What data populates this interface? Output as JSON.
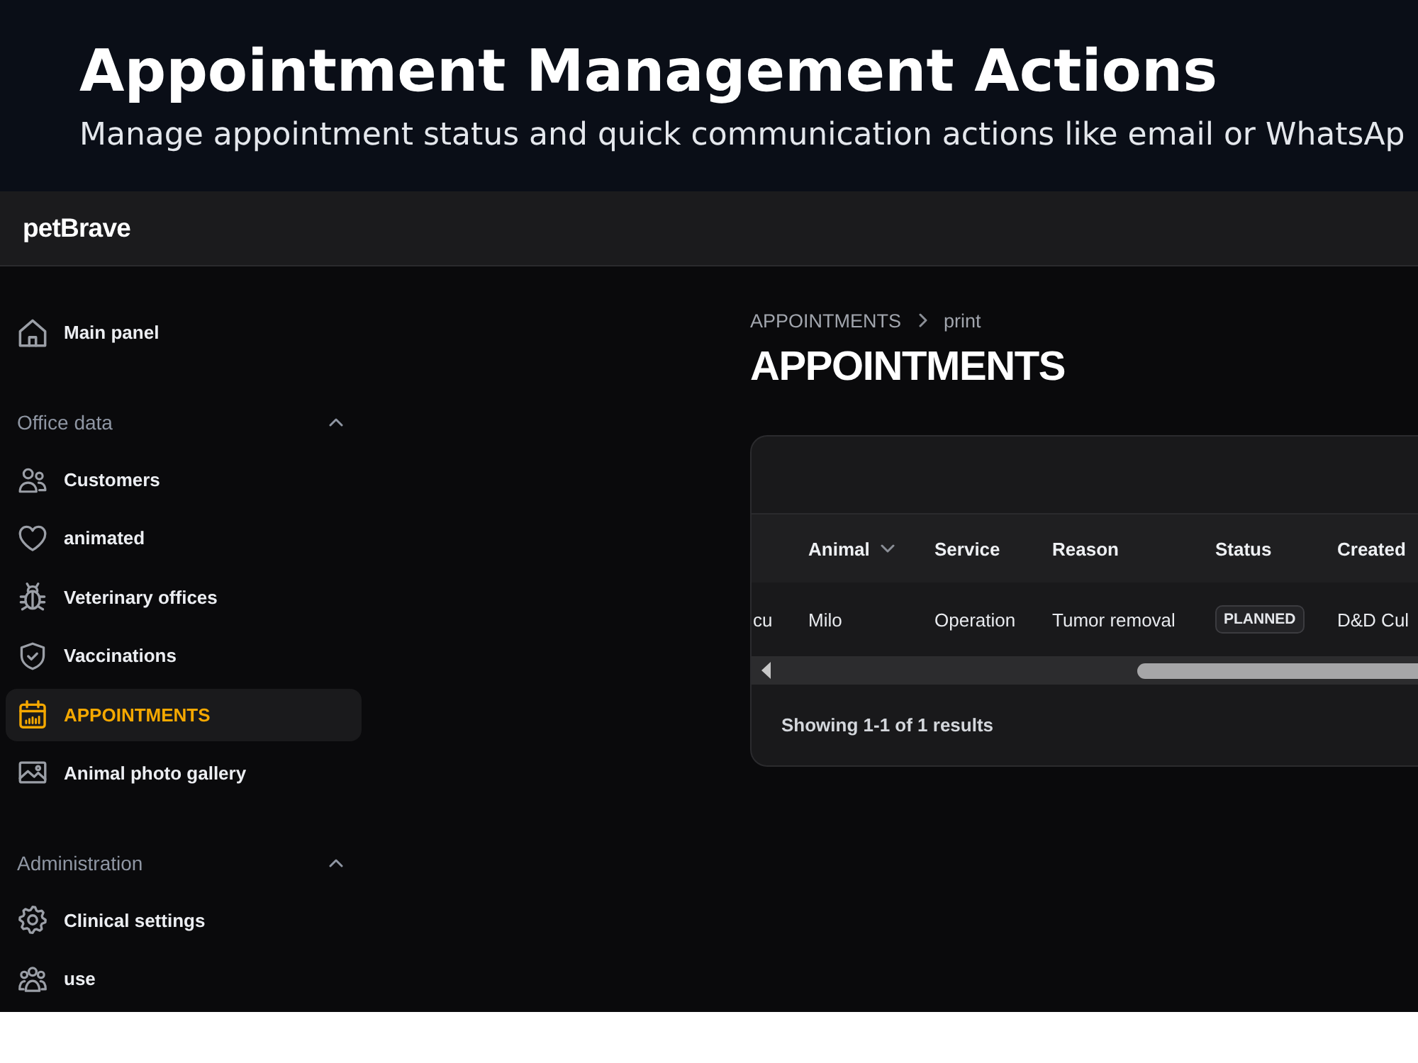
{
  "banner": {
    "title": "Appointment Management Actions",
    "subtitle": "Manage appointment status and quick communication actions like email or WhatsAp"
  },
  "top_bar": {
    "logo": "petBrave"
  },
  "sidebar": {
    "groups": [
      {
        "items": [
          {
            "label": "Main panel",
            "selected": false
          }
        ]
      },
      {
        "title": "Office data",
        "expanded": true,
        "items": [
          {
            "label": "Customers",
            "selected": false
          },
          {
            "label": "animated",
            "selected": false
          },
          {
            "label": "Veterinary offices",
            "selected": false
          },
          {
            "label": "Vaccinations",
            "selected": false
          },
          {
            "label": "APPOINTMENTS",
            "selected": true
          },
          {
            "label": "Animal photo gallery",
            "selected": false
          }
        ]
      },
      {
        "title": "Administration",
        "expanded": true,
        "items": [
          {
            "label": "Clinical settings",
            "selected": false
          },
          {
            "label": "use",
            "selected": false
          }
        ]
      }
    ]
  },
  "main": {
    "breadcrumb": [
      "APPOINTMENTS",
      "print"
    ],
    "title": "APPOINTMENTS",
    "table": {
      "columns": [
        {
          "sorted": false
        },
        {
          "label": "Animal",
          "sorted": true
        },
        {
          "label": "Service",
          "sorted": false
        },
        {
          "label": "Reason",
          "sorted": false
        },
        {
          "label": "Status",
          "sorted": false
        },
        {
          "label": "Created",
          "sorted": false
        }
      ],
      "rows": [
        {
          "cells": [
            {
              "kind": "text",
              "text": "cu"
            },
            {
              "kind": "text",
              "text": "Milo"
            },
            {
              "kind": "text",
              "text": "Operation"
            },
            {
              "kind": "text",
              "text": "Tumor removal"
            },
            {
              "kind": "badge",
              "text": "PLANNED"
            },
            {
              "kind": "text",
              "text": "D&D Cul"
            }
          ]
        }
      ],
      "summary": "Showing 1-1 of 1 results"
    }
  }
}
